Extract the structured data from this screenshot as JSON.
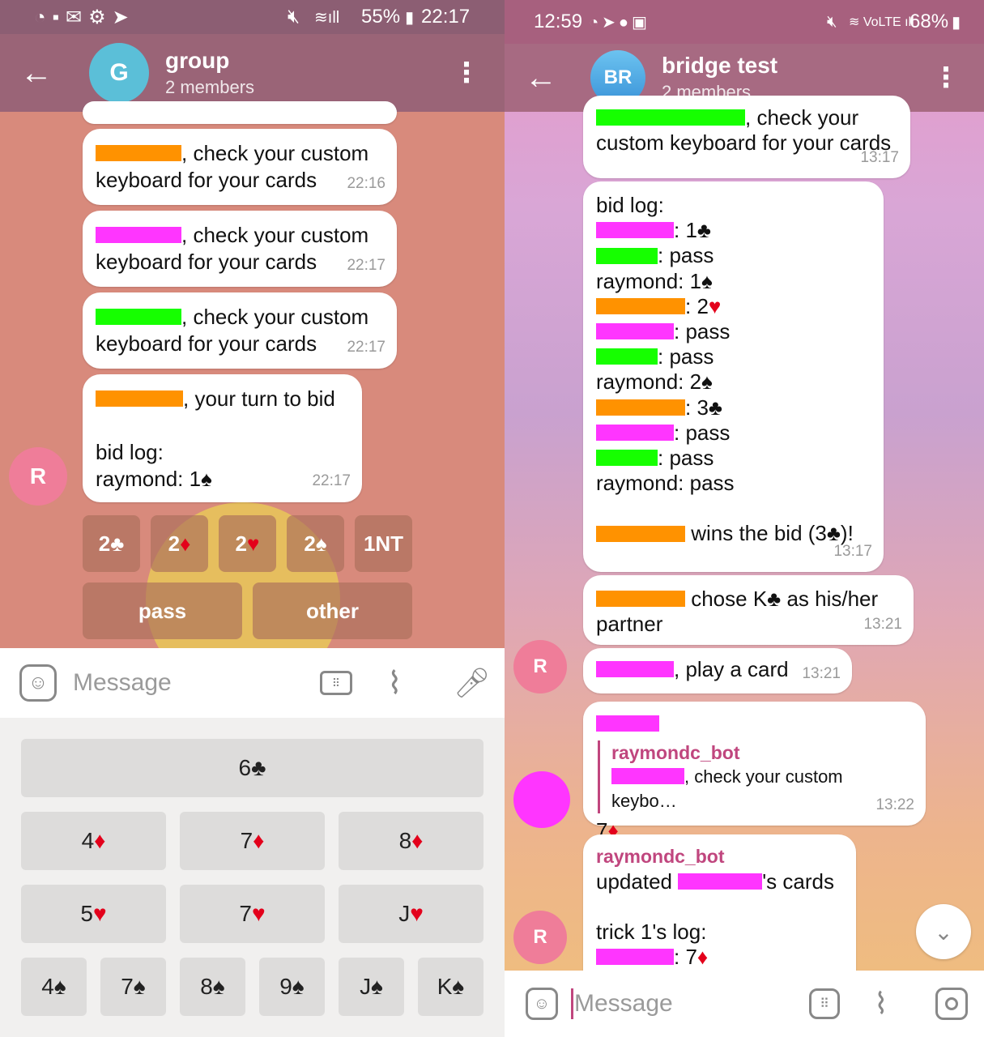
{
  "left": {
    "status": {
      "time": "22:17",
      "battery": "55%"
    },
    "header": {
      "avatar_letter": "G",
      "title": "group",
      "subtitle": "2 members"
    },
    "messages": [
      {
        "text": ", check your custom",
        "text2": "keyboard for your cards",
        "time": "22:16",
        "color": "#ff9200"
      },
      {
        "text": ", check your custom",
        "text2": "keyboard for your cards",
        "time": "22:17",
        "color": "#ff35ff"
      },
      {
        "text": ", check your custom",
        "text2": "keyboard for your cards",
        "time": "22:17",
        "color": "#16ff00"
      }
    ],
    "turn_msg": {
      "text": ", your turn to bid",
      "log_title": "bid log:",
      "log_line": "raymond: 1",
      "time": "22:17"
    },
    "sender_avatar": "R",
    "bid_buttons": [
      "2♣",
      "2♦",
      "2♥",
      "2♠",
      "1NT"
    ],
    "bid_buttons_row2": [
      "pass",
      "other"
    ],
    "composer": {
      "placeholder": "Message"
    },
    "keyboard": {
      "row1": [
        "6♣"
      ],
      "row2": [
        "4♦",
        "7♦",
        "8♦"
      ],
      "row3": [
        "5♥",
        "7♥",
        "J♥"
      ],
      "row4": [
        "4♠",
        "7♠",
        "8♠",
        "9♠",
        "J♠",
        "K♠"
      ]
    }
  },
  "right": {
    "status": {
      "time": "12:59",
      "battery": "68%"
    },
    "header": {
      "avatar_letters": "BR",
      "title": "bridge test",
      "subtitle": "2 members"
    },
    "msg1": {
      "text": ", check your",
      "text2": "custom keyboard for your cards",
      "time": "13:17"
    },
    "bidlog": {
      "title": "bid log:",
      "lines": [
        ": 1♣",
        ": pass",
        "raymond: 1♠",
        ": 2♥",
        ": pass",
        ": pass",
        "raymond: 2♠",
        ": 3♣",
        ": pass",
        ": pass",
        "raymond: pass"
      ],
      "wins": " wins the bid (3♣)!",
      "time": "13:17"
    },
    "partner": {
      "text": " chose K♣ as his/her",
      "text2": "partner",
      "time": "13:21"
    },
    "play": {
      "text": ", play a card",
      "time": "13:21"
    },
    "reply": {
      "fwd_name": "raymondc_bot",
      "quoted": ", check your custom keybo…",
      "card": "7♦",
      "time": "13:22"
    },
    "update": {
      "fwd_name": "raymondc_bot",
      "text": "updated ",
      "text_after": "'s cards",
      "log_title": "trick 1's log:",
      "log_line": ": 7♦"
    },
    "avatar_R": "R",
    "composer": {
      "placeholder": "Message"
    }
  }
}
